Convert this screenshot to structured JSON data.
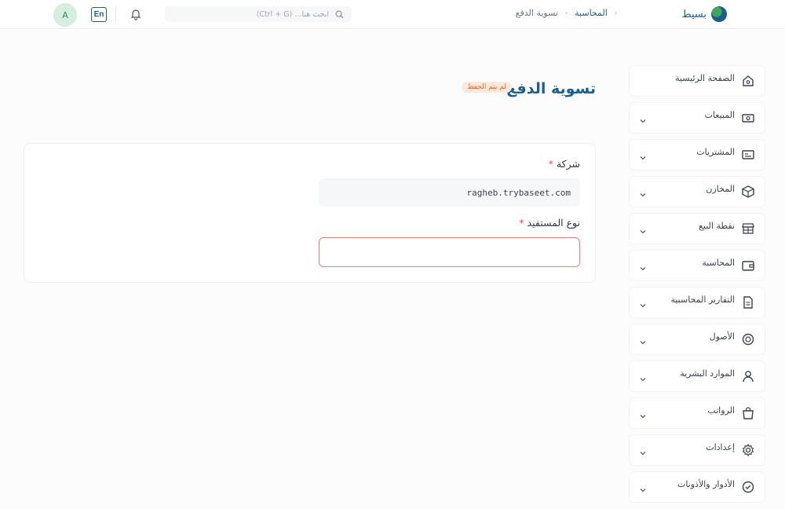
{
  "header": {
    "brand": "بسيط",
    "breadcrumb": [
      "المحاسبة",
      "تسوية الدفع"
    ],
    "search_placeholder": "ابحث هنا... (Ctrl + G)",
    "lang_button": "En",
    "avatar_initial": "A"
  },
  "sidebar": {
    "items": [
      {
        "label": "الصفحة الرئيسية",
        "icon": "home-icon",
        "chevron": false
      },
      {
        "label": "المبيعات",
        "icon": "cash-icon",
        "chevron": true
      },
      {
        "label": "المشتريات",
        "icon": "invoice-icon",
        "chevron": true
      },
      {
        "label": "المخازن",
        "icon": "box-icon",
        "chevron": true
      },
      {
        "label": "نقطة البيع",
        "icon": "store-icon",
        "chevron": true
      },
      {
        "label": "المحاسبة",
        "icon": "wallet-icon",
        "chevron": true
      },
      {
        "label": "التقارير المحاسبية",
        "icon": "report-icon",
        "chevron": true
      },
      {
        "label": "الأصول",
        "icon": "pie-icon",
        "chevron": true
      },
      {
        "label": "الموارد البشرية",
        "icon": "user-icon",
        "chevron": true
      },
      {
        "label": "الرواتب",
        "icon": "bag-icon",
        "chevron": true
      },
      {
        "label": "إعدادات",
        "icon": "gear-icon",
        "chevron": true
      },
      {
        "label": "الأدوار والأذونات",
        "icon": "check-icon",
        "chevron": true
      }
    ]
  },
  "main": {
    "title": "تسوية الدفع",
    "status_badge": "لم يتم الحفظ",
    "company_label": "شركة",
    "company_value": "ragheb.trybaseet.com",
    "beneficiary_label": "نوع المستفيد",
    "required_mark": "*",
    "beneficiary_value": ""
  },
  "colors": {
    "brand": "#1d5e92",
    "badge_bg": "#ffe9dc",
    "badge_text": "#e0662c",
    "error_border": "#e68080"
  }
}
